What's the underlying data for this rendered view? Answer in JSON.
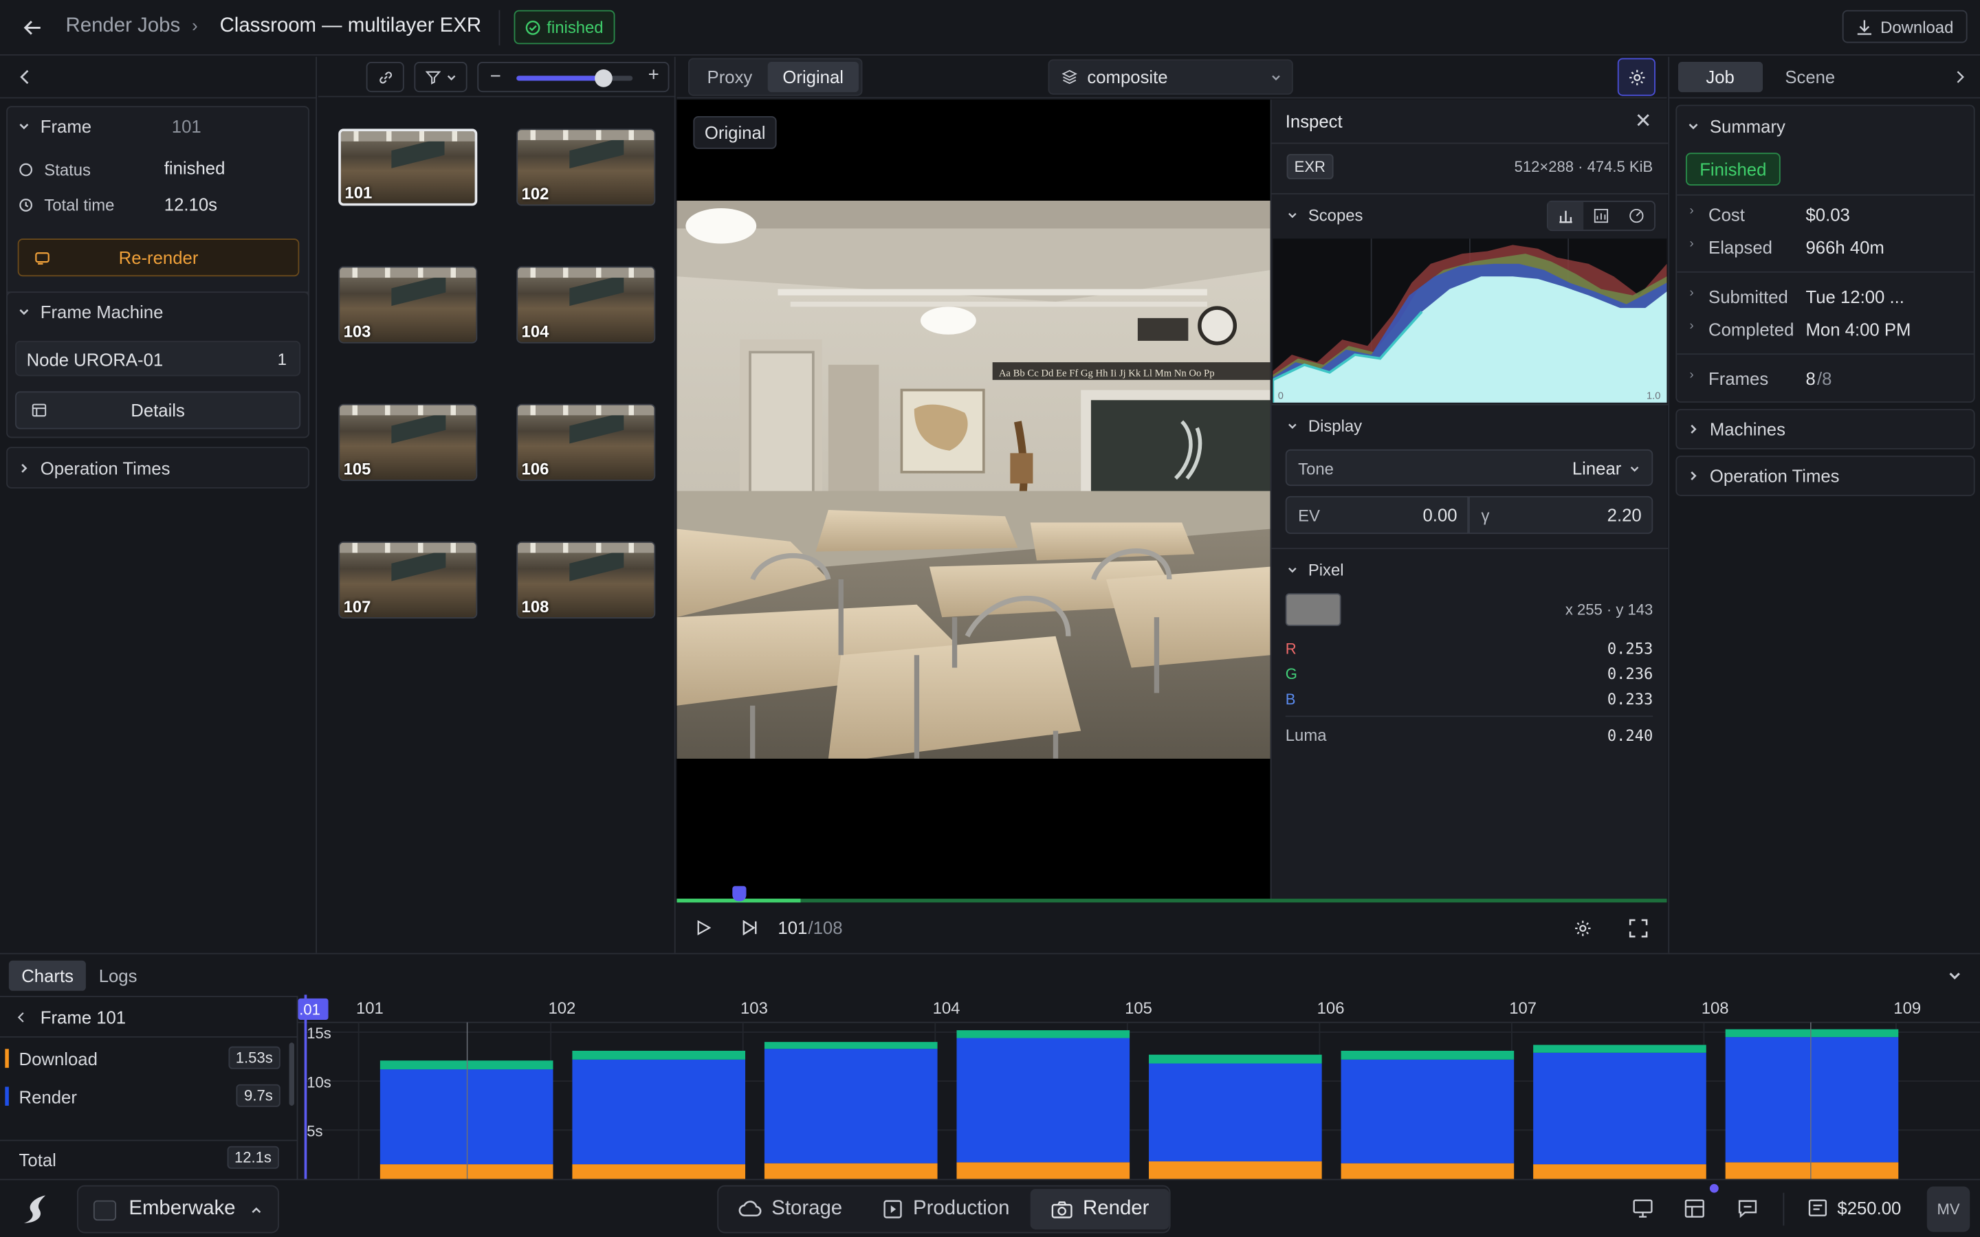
{
  "topbar": {
    "back_label": "Render Jobs",
    "title": "Classroom — multilayer EXR",
    "status": "finished",
    "download": "Download"
  },
  "frame_panel": {
    "label": "Frame",
    "number": "101",
    "status_label": "Status",
    "status_value": "finished",
    "total_label": "Total time",
    "total_value": "12.10s",
    "rerender": "Re-render"
  },
  "machine_panel": {
    "label": "Frame Machine",
    "node": "Node URORA-01",
    "node_count": "1",
    "details": "Details"
  },
  "op_times": "Operation Times",
  "thumbnails": [
    {
      "n": "101"
    },
    {
      "n": "102"
    },
    {
      "n": "103"
    },
    {
      "n": "104"
    },
    {
      "n": "105"
    },
    {
      "n": "106"
    },
    {
      "n": "107"
    },
    {
      "n": "108"
    }
  ],
  "thumb_zoom_fraction": 0.75,
  "viewer": {
    "proxy": "Proxy",
    "original": "Original",
    "layer": "composite",
    "overlay_label": "Original",
    "frame_current": "101",
    "frame_total": "/108"
  },
  "inspect": {
    "title": "Inspect",
    "format": "EXR",
    "meta": "512×288 · 474.5 KiB",
    "scopes": "Scopes",
    "axis_min": "0",
    "axis_max": "1.0",
    "display": "Display",
    "tone_label": "Tone",
    "tone_value": "Linear",
    "ev_label": "EV",
    "ev_value": "0.00",
    "gamma_label": "γ",
    "gamma_value": "2.20",
    "pixel": "Pixel",
    "coords": "x 255 · y 143",
    "r_label": "R",
    "r": "0.253",
    "g_label": "G",
    "g": "0.236",
    "b_label": "B",
    "b": "0.233",
    "luma_label": "Luma",
    "luma": "0.240",
    "swatch_color": "#7b7b7b"
  },
  "right_panel": {
    "tab_job": "Job",
    "tab_scene": "Scene",
    "summary": "Summary",
    "finished": "Finished",
    "cost_label": "Cost",
    "cost": "$0.03",
    "elapsed_label": "Elapsed",
    "elapsed": "966h 40m",
    "submitted_label": "Submitted",
    "submitted": "Tue 12:00 ...",
    "completed_label": "Completed",
    "completed": "Mon 4:00 PM",
    "frames_label": "Frames",
    "frames_done": "8",
    "frames_total": "/8",
    "machines": "Machines",
    "op_times": "Operation Times"
  },
  "bottom": {
    "tab_charts": "Charts",
    "tab_logs": "Logs",
    "frame_label": "Frame 101",
    "download_label": "Download",
    "download_value": "1.53s",
    "render_label": "Render",
    "render_value": "9.7s",
    "total_label": "Total",
    "total_value": "12.1s",
    "playhead_label": ".01"
  },
  "chart_data": {
    "type": "bar",
    "categories": [
      "101",
      "102",
      "103",
      "104",
      "105",
      "106",
      "107",
      "108"
    ],
    "x_ticks": [
      "101",
      "102",
      "103",
      "104",
      "105",
      "106",
      "107",
      "108",
      "109"
    ],
    "y_ticks": [
      "15s",
      "10s",
      "5s"
    ],
    "ylim": [
      0,
      16
    ],
    "series": [
      {
        "name": "Download",
        "color": "#f7941d",
        "values": [
          1.5,
          1.5,
          1.6,
          1.7,
          1.8,
          1.6,
          1.5,
          1.7
        ]
      },
      {
        "name": "Render",
        "color": "#1f4fe8",
        "values": [
          9.7,
          10.7,
          11.7,
          12.7,
          10.0,
          10.6,
          11.4,
          12.8
        ]
      },
      {
        "name": "",
        "color": "#12b981",
        "values": [
          0.9,
          0.9,
          0.7,
          0.8,
          0.9,
          0.9,
          0.8,
          0.8
        ]
      }
    ]
  },
  "footer": {
    "workspace": "Emberwake",
    "storage": "Storage",
    "production": "Production",
    "render": "Render",
    "credit": "$250.00",
    "initials": "MV"
  }
}
